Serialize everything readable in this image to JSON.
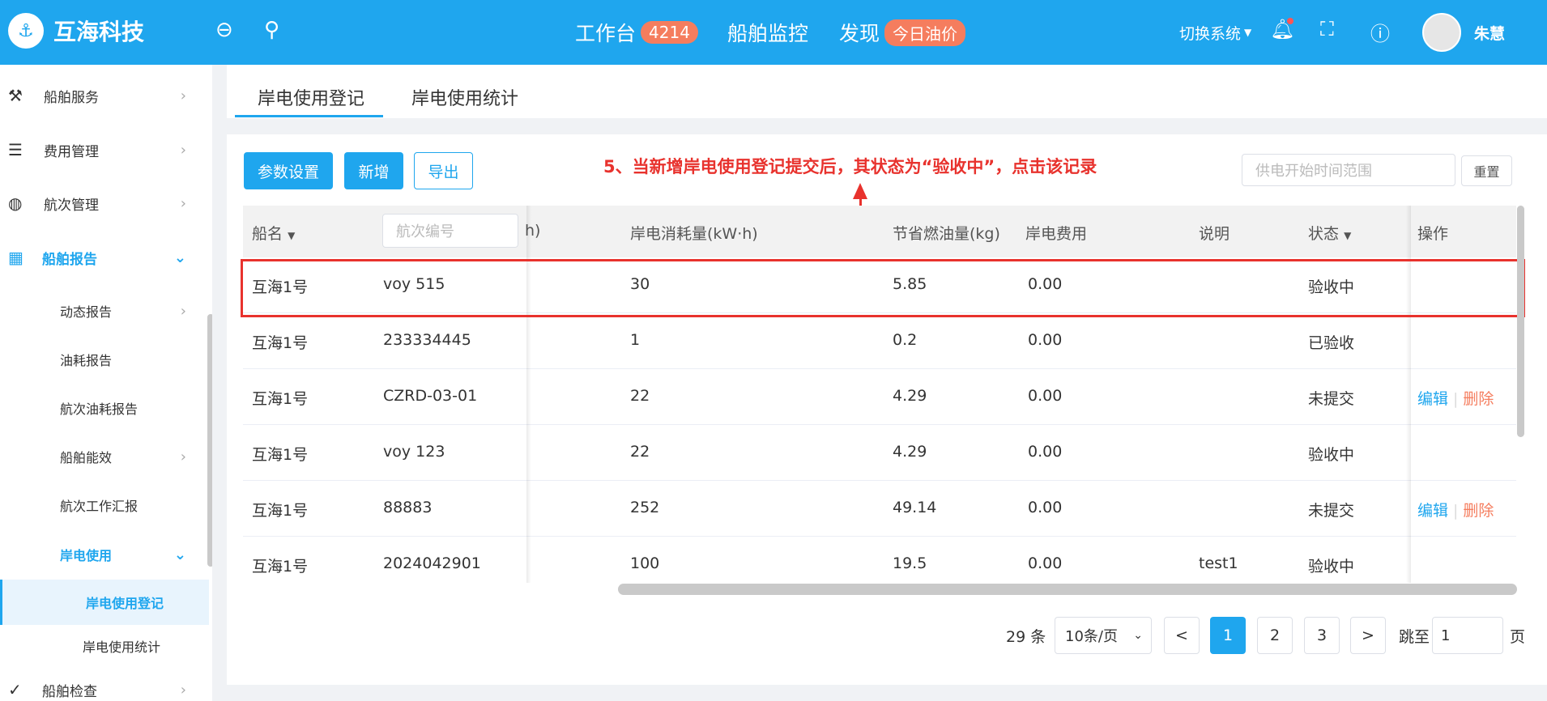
{
  "header": {
    "brand": "互海科技",
    "nav": [
      {
        "label": "工作台",
        "badge": "4214"
      },
      {
        "label": "船舶监控"
      },
      {
        "label": "发现",
        "badge": "今日油价"
      }
    ],
    "switch_system": "切换系统",
    "user": "朱慧"
  },
  "sidebar": {
    "items": [
      {
        "label": "船舶服务"
      },
      {
        "label": "费用管理"
      },
      {
        "label": "航次管理"
      },
      {
        "label": "船舶报告"
      },
      {
        "label": "动态报告"
      },
      {
        "label": "油耗报告"
      },
      {
        "label": "航次油耗报告"
      },
      {
        "label": "船舶能效"
      },
      {
        "label": "航次工作汇报"
      },
      {
        "label": "岸电使用"
      },
      {
        "label": "岸电使用登记"
      },
      {
        "label": "岸电使用统计"
      },
      {
        "label": "船舶检查"
      }
    ]
  },
  "tabs": [
    "岸电使用登记",
    "岸电使用统计"
  ],
  "toolbar": {
    "params": "参数设置",
    "add": "新增",
    "export": "导出",
    "date_range_placeholder": "供电开始时间范围",
    "reset": "重置"
  },
  "annotation": "5、当新增岸电使用登记提交后，其状态为“验收中”，点击该记录",
  "table": {
    "headers": {
      "ship": "船名",
      "voyage_placeholder": "航次编号",
      "hidden_tail": "h)",
      "consumption": "岸电消耗量(kW·h)",
      "fuel_saved": "节省燃油量(kg)",
      "cost": "岸电费用",
      "note": "说明",
      "status": "状态",
      "ops": "操作"
    },
    "rows": [
      {
        "ship": "互海1号",
        "voyage": "voy 515",
        "consumption": "30",
        "fuel_saved": "5.85",
        "cost": "0.00",
        "note": "",
        "status": "验收中",
        "edit": "",
        "del": ""
      },
      {
        "ship": "互海1号",
        "voyage": "233334445",
        "consumption": "1",
        "fuel_saved": "0.2",
        "cost": "0.00",
        "note": "",
        "status": "已验收",
        "edit": "",
        "del": ""
      },
      {
        "ship": "互海1号",
        "voyage": "CZRD-03-01",
        "consumption": "22",
        "fuel_saved": "4.29",
        "cost": "0.00",
        "note": "",
        "status": "未提交",
        "edit": "编辑",
        "del": "删除"
      },
      {
        "ship": "互海1号",
        "voyage": "voy 123",
        "consumption": "22",
        "fuel_saved": "4.29",
        "cost": "0.00",
        "note": "",
        "status": "验收中",
        "edit": "",
        "del": ""
      },
      {
        "ship": "互海1号",
        "voyage": "88883",
        "consumption": "252",
        "fuel_saved": "49.14",
        "cost": "0.00",
        "note": "",
        "status": "未提交",
        "edit": "编辑",
        "del": "删除"
      },
      {
        "ship": "互海1号",
        "voyage": "2024042901",
        "consumption": "100",
        "fuel_saved": "19.5",
        "cost": "0.00",
        "note": "test1",
        "status": "验收中",
        "edit": "",
        "del": ""
      }
    ]
  },
  "pagination": {
    "total": "29 条",
    "page_size": "10条/页",
    "prev": "<",
    "pages": [
      "1",
      "2",
      "3"
    ],
    "next": ">",
    "jump_label": "跳至",
    "jump_value": "1",
    "page_suffix": "页"
  },
  "colors": {
    "primary": "#1fa6ee",
    "danger": "#e8322d",
    "accent": "#f57d5e"
  }
}
